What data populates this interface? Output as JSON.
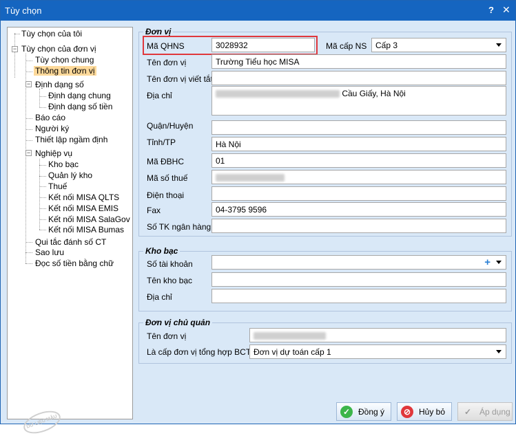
{
  "window": {
    "title": "Tùy chọn",
    "help": "?",
    "close": "✕"
  },
  "tree": {
    "items": [
      "Tùy chọn của tôi",
      "Tùy chọn của đơn vị",
      "Tùy chọn chung",
      "Thông tin đơn vị",
      "Định dạng số",
      "Định dạng chung",
      "Định dạng số tiền",
      "Báo cáo",
      "Người ký",
      "Thiết lập ngầm định",
      "Nghiệp vụ",
      "Kho bạc",
      "Quản lý kho",
      "Thuế",
      "Kết nối MISA QLTS",
      "Kết nối MISA EMIS",
      "Kết nối MISA SalaGov",
      "Kết nối MISA Bumas",
      "Qui tắc đánh số CT",
      "Sao lưu",
      "Đọc số tiền bằng chữ"
    ],
    "toggle_minus": "−",
    "stamp": "DỮ LIỆU MẪU"
  },
  "don_vi": {
    "title": "Đơn vị",
    "ma_qhns_label": "Mã QHNS",
    "ma_qhns_value": "3028932",
    "ma_cap_ns_label": "Mã cấp NS",
    "ma_cap_ns_value": "Cấp 3",
    "ten_don_vi_label": "Tên đơn vị",
    "ten_don_vi_value": "Trường Tiểu học MISA",
    "ten_viet_tat_label": "Tên đơn vị viết tắt",
    "ten_viet_tat_value": "",
    "dia_chi_label": "Địa chỉ",
    "dia_chi_value": "Cầu Giấy, Hà Nội",
    "quan_huyen_label": "Quận/Huyện",
    "quan_huyen_value": "",
    "tinh_tp_label": "Tỉnh/TP",
    "tinh_tp_value": "Hà Nội",
    "ma_dbhc_label": "Mã ĐBHC",
    "ma_dbhc_value": "01",
    "ma_so_thue_label": "Mã số thuế",
    "dien_thoai_label": "Điện thoại",
    "dien_thoai_value": "",
    "fax_label": "Fax",
    "fax_value": "04-3795 9596",
    "so_tk_label": "Số TK ngân hàng",
    "so_tk_value": ""
  },
  "kho_bac": {
    "title": "Kho bạc",
    "so_tai_khoan_label": "Số tài khoản",
    "so_tai_khoan_value": "",
    "plus": "+",
    "ten_kho_bac_label": "Tên kho bạc",
    "ten_kho_bac_value": "",
    "dia_chi_label": "Địa chỉ",
    "dia_chi_value": ""
  },
  "chu_quan": {
    "title": "Đơn vị chủ quản",
    "ten_don_vi_label": "Tên đơn vị",
    "la_cap_label": "Là cấp đơn vị tổng hợp BCTC",
    "la_cap_value": "Đơn vị dự toán cấp 1"
  },
  "buttons": {
    "ok": "Đồng ý",
    "cancel": "Hủy bỏ",
    "apply": "Áp dụng",
    "ok_glyph": "✓",
    "cancel_glyph": "⊘",
    "apply_glyph": "✓"
  },
  "colors": {
    "titlebar": "#1565c0",
    "panel": "#d9e8f7",
    "selected": "#fdd99a",
    "highlight": "#e0373b",
    "ok_icon": "#3cb54a",
    "cancel_icon": "#e0373b"
  }
}
